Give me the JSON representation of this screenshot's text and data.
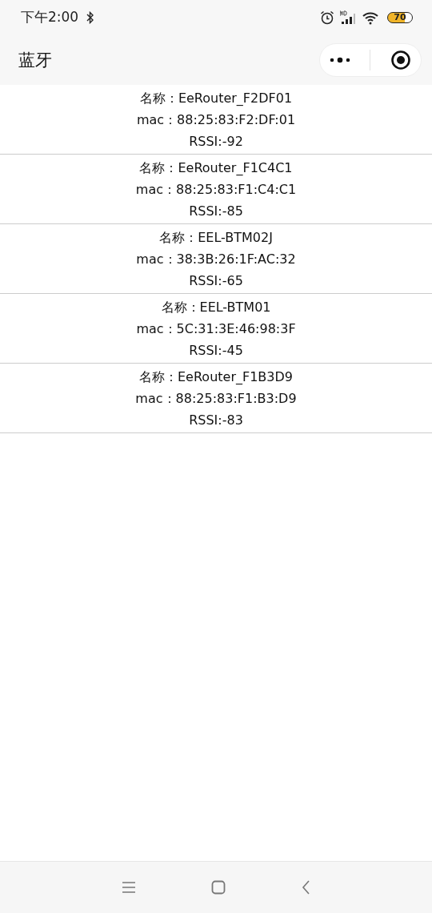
{
  "status_bar": {
    "time": "下午2:00",
    "battery": "70"
  },
  "title": "蓝牙",
  "devices": [
    {
      "name": "名称：EeRouter_F2DF01",
      "mac": "mac：88:25:83:F2:DF:01",
      "rssi": "RSSI:-92"
    },
    {
      "name": "名称：EeRouter_F1C4C1",
      "mac": "mac：88:25:83:F1:C4:C1",
      "rssi": "RSSI:-85"
    },
    {
      "name": "名称：EEL-BTM02J",
      "mac": "mac：38:3B:26:1F:AC:32",
      "rssi": "RSSI:-65"
    },
    {
      "name": "名称：EEL-BTM01",
      "mac": "mac：5C:31:3E:46:98:3F",
      "rssi": "RSSI:-45"
    },
    {
      "name": "名称：EeRouter_F1B3D9",
      "mac": "mac：88:25:83:F1:B3:D9",
      "rssi": "RSSI:-83"
    }
  ]
}
